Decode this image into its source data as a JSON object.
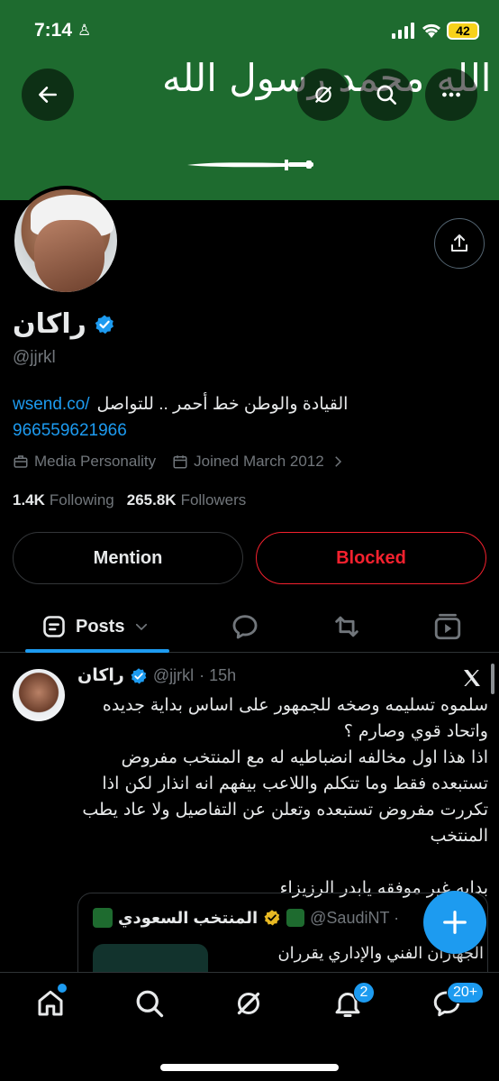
{
  "status_bar": {
    "time": "7:14",
    "battery": "42"
  },
  "banner": {
    "arabic_text": "لا إله إلا الله محمد رسول الله",
    "color": "#1e6b2f"
  },
  "header_buttons": {
    "back_icon": "arrow-left-icon",
    "grok_icon": "grok-icon",
    "search_icon": "search-icon",
    "more_icon": "more-icon"
  },
  "profile": {
    "name": "راكان",
    "handle": "@jjrkl",
    "bio_link": "wsend.co/",
    "bio_text": "القيادة والوطن خط أحمر .. للتواصل",
    "bio_phone": "966559621966",
    "category": "Media Personality",
    "joined": "Joined March 2012",
    "following_count": "1.4K",
    "following_label": "Following",
    "followers_count": "265.8K",
    "followers_label": "Followers"
  },
  "actions": {
    "mention": "Mention",
    "blocked": "Blocked"
  },
  "tabs": {
    "posts": "Posts"
  },
  "tweet": {
    "name": "راكان",
    "handle": "@jjrkl",
    "time": "· 15h",
    "lines": [
      "سلموه تسليمه وصخه للجمهور على اساس بداية جديده",
      "واتحاد قوي وصارم ؟",
      "اذا هذا اول مخالفه انضباطيه له مع المنتخب مفروض",
      "تستبعده فقط وما تتكلم واللاعب بيفهم انه انذار لكن اذا",
      "تكررت مفروض تستبعده وتعلن عن التفاصيل ولا عاد يطب",
      "المنتخب"
    ],
    "last_line": "بدايه غير موفقه يابدر الرزيزاء",
    "quote": {
      "name": "المنتخب السعودي",
      "handle": "@SaudiNT ·",
      "text": "الجهازان الفني والإداري يقرران"
    }
  },
  "bottom_nav": {
    "notifications_badge": "2",
    "messages_badge": "20+"
  },
  "colors": {
    "accent": "#1d9bf0",
    "danger": "#f4212e",
    "muted": "#71767b"
  }
}
